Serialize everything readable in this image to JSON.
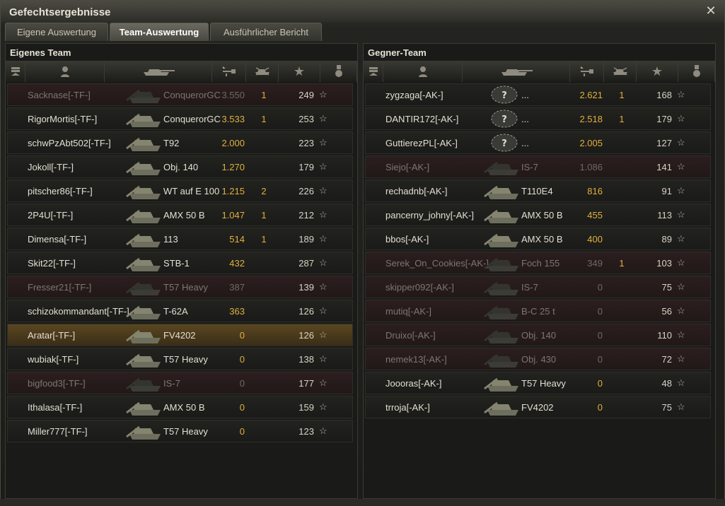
{
  "window": {
    "title": "Gefechtsergebnisse"
  },
  "tabs": [
    {
      "label": "Eigene Auswertung"
    },
    {
      "label": "Team-Auswertung"
    },
    {
      "label": "Ausführlicher Bericht"
    }
  ],
  "active_tab": 1,
  "own_team": {
    "title": "Eigenes Team",
    "players": [
      {
        "name": "Sacknase[-TF-]",
        "tank": "ConquerorGC",
        "damage": "3.550",
        "frags": "1",
        "xp": "249",
        "state": "dead"
      },
      {
        "name": "RigorMortis[-TF-]",
        "tank": "ConquerorGC",
        "damage": "3.533",
        "frags": "1",
        "xp": "253",
        "state": "alive"
      },
      {
        "name": "schwPzAbt502[-TF-]",
        "tank": "T92",
        "damage": "2.000",
        "frags": "",
        "xp": "223",
        "state": "alive"
      },
      {
        "name": "Jokoll[-TF-]",
        "tank": "Obj. 140",
        "damage": "1.270",
        "frags": "",
        "xp": "179",
        "state": "alive"
      },
      {
        "name": "pitscher86[-TF-]",
        "tank": "WT auf E 100",
        "damage": "1.215",
        "frags": "2",
        "xp": "226",
        "state": "alive"
      },
      {
        "name": "2P4U[-TF-]",
        "tank": "AMX 50 B",
        "damage": "1.047",
        "frags": "1",
        "xp": "212",
        "state": "alive"
      },
      {
        "name": "Dimensa[-TF-]",
        "tank": "113",
        "damage": "514",
        "frags": "1",
        "xp": "189",
        "state": "alive"
      },
      {
        "name": "Skit22[-TF-]",
        "tank": "STB-1",
        "damage": "432",
        "frags": "",
        "xp": "287",
        "state": "alive"
      },
      {
        "name": "Fresser21[-TF-]",
        "tank": "T57 Heavy",
        "damage": "387",
        "frags": "",
        "xp": "139",
        "state": "dead"
      },
      {
        "name": "schizokommandant[-TF-]",
        "tank": "T-62A",
        "damage": "363",
        "frags": "",
        "xp": "126",
        "state": "alive"
      },
      {
        "name": "Aratar[-TF-]",
        "tank": "FV4202",
        "damage": "0",
        "frags": "",
        "xp": "126",
        "state": "self"
      },
      {
        "name": "wubiak[-TF-]",
        "tank": "T57 Heavy",
        "damage": "0",
        "frags": "",
        "xp": "138",
        "state": "alive"
      },
      {
        "name": "bigfood3[-TF-]",
        "tank": "IS-7",
        "damage": "0",
        "frags": "",
        "xp": "177",
        "state": "dead"
      },
      {
        "name": "Ithalasa[-TF-]",
        "tank": "AMX 50 B",
        "damage": "0",
        "frags": "",
        "xp": "159",
        "state": "alive"
      },
      {
        "name": "Miller777[-TF-]",
        "tank": "T57 Heavy",
        "damage": "0",
        "frags": "",
        "xp": "123",
        "state": "alive"
      }
    ]
  },
  "enemy_team": {
    "title": "Gegner-Team",
    "players": [
      {
        "name": "zygzaga[-AK-]",
        "tank": "...",
        "damage": "2.621",
        "frags": "1",
        "xp": "168",
        "state": "alive",
        "unknown": true
      },
      {
        "name": "DANTIR172[-AK-]",
        "tank": "...",
        "damage": "2.518",
        "frags": "1",
        "xp": "179",
        "state": "alive",
        "unknown": true
      },
      {
        "name": "GuttierezPL[-AK-]",
        "tank": "...",
        "damage": "2.005",
        "frags": "",
        "xp": "127",
        "state": "alive",
        "unknown": true
      },
      {
        "name": "Siejo[-AK-]",
        "tank": "IS-7",
        "damage": "1.086",
        "frags": "",
        "xp": "141",
        "state": "dead"
      },
      {
        "name": "rechadnb[-AK-]",
        "tank": "T110E4",
        "damage": "816",
        "frags": "",
        "xp": "91",
        "state": "alive"
      },
      {
        "name": "pancerny_johny[-AK-]",
        "tank": "AMX 50 B",
        "damage": "455",
        "frags": "",
        "xp": "113",
        "state": "alive"
      },
      {
        "name": "bbos[-AK-]",
        "tank": "AMX 50 B",
        "damage": "400",
        "frags": "",
        "xp": "89",
        "state": "alive"
      },
      {
        "name": "Serek_On_Cookies[-AK-]",
        "tank": "Foch 155",
        "damage": "349",
        "frags": "1",
        "xp": "103",
        "state": "dead"
      },
      {
        "name": "skipper092[-AK-]",
        "tank": "IS-7",
        "damage": "0",
        "frags": "",
        "xp": "75",
        "state": "dead"
      },
      {
        "name": "mutiq[-AK-]",
        "tank": "B-C 25 t",
        "damage": "0",
        "frags": "",
        "xp": "56",
        "state": "dead"
      },
      {
        "name": "Druixo[-AK-]",
        "tank": "Obj. 140",
        "damage": "0",
        "frags": "",
        "xp": "110",
        "state": "dead"
      },
      {
        "name": "nemek13[-AK-]",
        "tank": "Obj. 430",
        "damage": "0",
        "frags": "",
        "xp": "72",
        "state": "dead"
      },
      {
        "name": "Joooras[-AK-]",
        "tank": "T57 Heavy",
        "damage": "0",
        "frags": "",
        "xp": "48",
        "state": "alive"
      },
      {
        "name": "trroja[-AK-]",
        "tank": "FV4202",
        "damage": "0",
        "frags": "",
        "xp": "75",
        "state": "alive"
      }
    ]
  },
  "columns": [
    {
      "icon": "squad-icon"
    },
    {
      "icon": "player-icon"
    },
    {
      "icon": "tank-icon"
    },
    {
      "icon": "damage-icon"
    },
    {
      "icon": "frags-icon"
    },
    {
      "icon": "xp-star-icon"
    },
    {
      "icon": "medal-icon"
    }
  ],
  "colors": {
    "damage": "#e0b040",
    "text": "#e2dfd2",
    "dead_row": "#2c1e1e",
    "self_row": "#5a4620"
  }
}
